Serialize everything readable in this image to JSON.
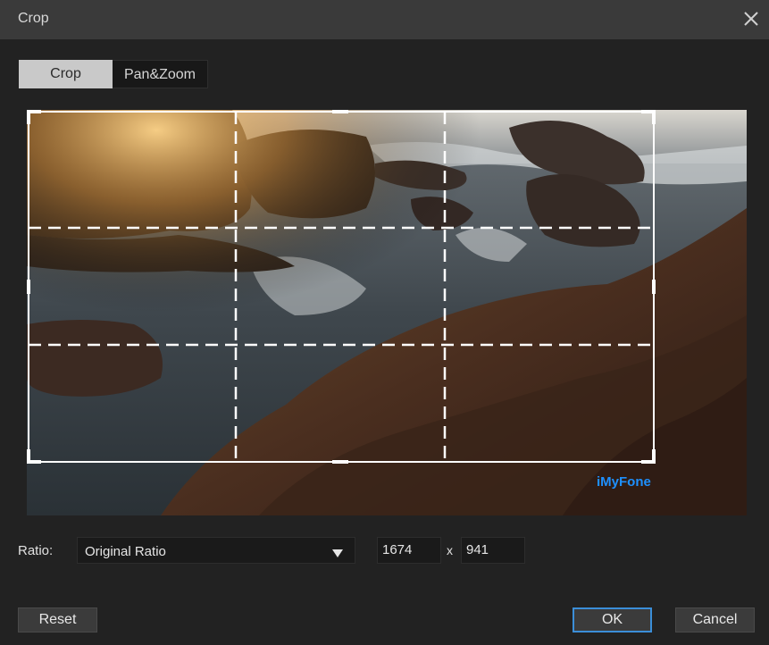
{
  "dialog": {
    "title": "Crop",
    "close_icon": "close-icon"
  },
  "tabs": [
    {
      "label": "Crop",
      "active": true
    },
    {
      "label": "Pan&Zoom",
      "active": false
    }
  ],
  "preview": {
    "image": "rocky seashore at sunset with waves",
    "watermark": "iMyFone",
    "crop_overlay": "rule-of-thirds dashed grid with corner handles"
  },
  "ratio": {
    "label": "Ratio:",
    "selected": "Original Ratio",
    "arrow_icon": "triangle-down-icon"
  },
  "dimensions": {
    "width": "1674",
    "separator": "x",
    "height": "941"
  },
  "buttons": {
    "reset": "Reset",
    "ok": "OK",
    "cancel": "Cancel"
  },
  "colors": {
    "background": "#222222",
    "titlebar": "#3a3a3a",
    "accent": "#3b8ed8",
    "watermark": "#1e90ff"
  }
}
